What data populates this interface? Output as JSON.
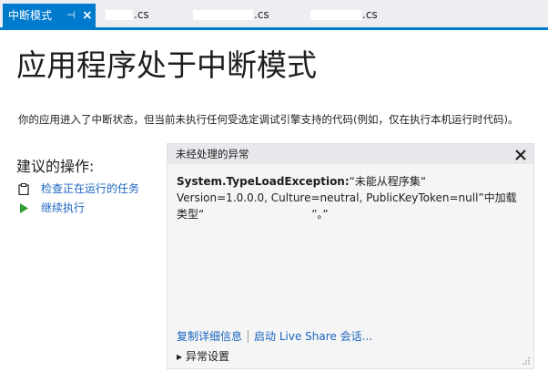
{
  "tabs": [
    {
      "label": "中断模式",
      "pin_icon": "pin-icon",
      "close_icon": "close-icon",
      "active": true
    },
    {
      "label": ".cs",
      "active": false
    },
    {
      "label": ".cs",
      "active": false
    },
    {
      "label": ".cs",
      "active": false
    }
  ],
  "page": {
    "title": "应用程序处于中断模式",
    "description": "你的应用进入了中断状态，但当前未执行任何受选定调试引擎支持的代码(例如，仅在执行本机运行时代码)。"
  },
  "actions": {
    "heading": "建议的操作:",
    "items": [
      {
        "label": "检查正在运行的任务",
        "icon": "clipboard-icon"
      },
      {
        "label": "继续执行",
        "icon": "play-icon"
      }
    ]
  },
  "exception_panel": {
    "title": "未经处理的异常",
    "exception_type": "System.TypeLoadException:",
    "message_1": "“未能从程序集“",
    "message_2": "Version=1.0.0.0, Culture=neutral, PublicKeyToken=null”中加载",
    "message_3": "类型“",
    "message_4": "”。”",
    "links": {
      "copy_details": "复制详细信息",
      "live_share": "启动 Live Share 会话..."
    },
    "settings_label": "异常设置"
  },
  "colors": {
    "accent": "#007acc",
    "link": "#1a65c0",
    "play_green": "#2f9e2f"
  }
}
